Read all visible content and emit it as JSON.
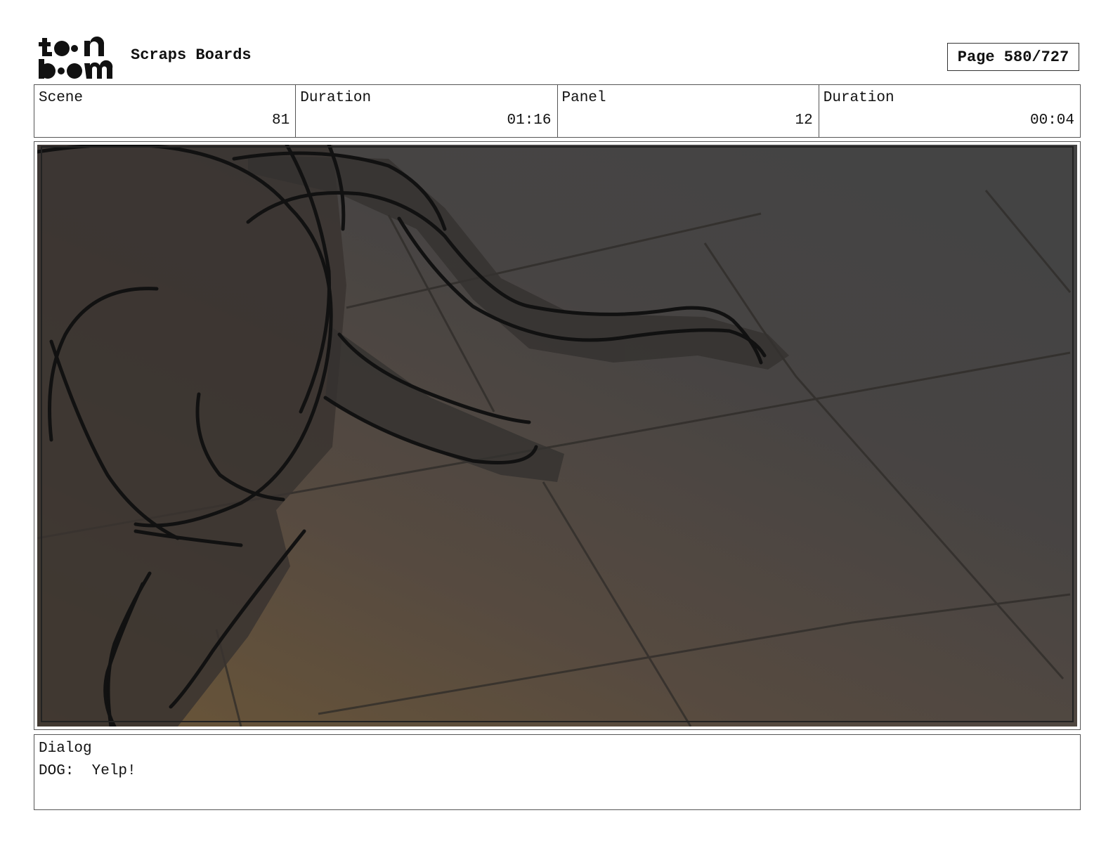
{
  "header": {
    "logo_text_top": "toon",
    "logo_text_bottom": "boom",
    "title": "Scraps Boards",
    "page_label": "Page 580/727"
  },
  "info": [
    {
      "label": "Scene",
      "value": "81"
    },
    {
      "label": "Duration",
      "value": "01:16"
    },
    {
      "label": "Panel",
      "value": "12"
    },
    {
      "label": "Duration",
      "value": "00:04"
    }
  ],
  "dialog": {
    "label": "Dialog",
    "text": "DOG:  Yelp!"
  },
  "colors": {
    "floor": "#454545",
    "warm_shadow": "#5e4d3a",
    "ink": "#111111"
  }
}
